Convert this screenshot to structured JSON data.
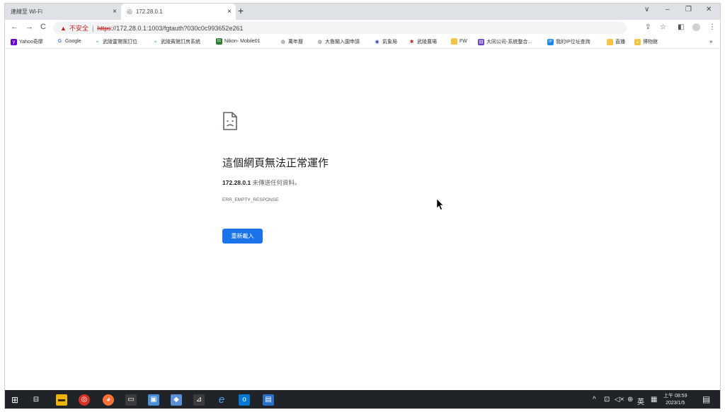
{
  "tabs": [
    {
      "label": "連線至 Wi-Fi",
      "close": "×"
    },
    {
      "label": "172.28.0.1",
      "close": "×"
    }
  ],
  "newtab": "+",
  "window_controls": {
    "chevron": "∨",
    "minimize": "–",
    "restore": "❐",
    "close": "✕"
  },
  "nav": {
    "back": "←",
    "forward": "→",
    "reload": "C"
  },
  "address": {
    "warning": "▲",
    "insecure": "不安全",
    "separator": "|",
    "scheme": "https",
    "rest": "://172.28.0.1:1003/fgtauth?030c0c993652e261"
  },
  "toolbar_icons": {
    "share": "⇪",
    "star": "☆",
    "sidepanel": "◧",
    "menu": "⋮"
  },
  "bookmarks": [
    {
      "label": "Yahoo奇摩",
      "color": "#6001d2",
      "glyph": "y"
    },
    {
      "label": "Google",
      "color": "#4285f4",
      "glyph": "G"
    },
    {
      "label": "武陵靈鷲匯訂位",
      "color": "#34a853",
      "glyph": "⌁"
    },
    {
      "label": "武陵賓館訂房系統",
      "color": "#34a853",
      "glyph": "⌁"
    },
    {
      "label": "Nikon- Mobile01",
      "color": "#2e7d32",
      "glyph": "01"
    },
    {
      "label": "萬年曆",
      "color": "#5f6368",
      "glyph": "◍"
    },
    {
      "label": "大魯閣入園申請",
      "color": "#5f6368",
      "glyph": "◍"
    },
    {
      "label": "氣象局",
      "color": "#3949ab",
      "glyph": "◉"
    },
    {
      "label": "武陵農場",
      "color": "#c62828",
      "glyph": "✱"
    },
    {
      "label": "FW",
      "color": "#f6c343",
      "glyph": ""
    },
    {
      "label": "大同公司-系統整合...",
      "color": "#673ab7",
      "glyph": "▤"
    },
    {
      "label": "我的IP位址查詢",
      "color": "#1e88e5",
      "glyph": "IP"
    },
    {
      "label": "直播",
      "color": "#f6c343",
      "glyph": ""
    },
    {
      "label": "博物館",
      "color": "#f6c343",
      "glyph": "◒"
    }
  ],
  "bookmarks_more": "»",
  "error": {
    "title": "這個網頁無法正常運作",
    "host": "172.28.0.1",
    "message": " 未傳送任何資料。",
    "code": "ERR_EMPTY_RESPONSE",
    "reload_label": "重新載入"
  },
  "taskbar": {
    "apps": [
      {
        "name": "start",
        "glyph": "⊞",
        "color": "#202428"
      },
      {
        "name": "task-view",
        "glyph": "⊟",
        "color": "#202428"
      },
      {
        "name": "file-explorer",
        "glyph": "▬",
        "color": "#f0b400"
      },
      {
        "name": "chrome",
        "glyph": "◎",
        "color": "#d93025"
      },
      {
        "name": "firefox",
        "glyph": "◕",
        "color": "#ff7139"
      },
      {
        "name": "terminal",
        "glyph": "▭",
        "color": "#3c3c3c"
      },
      {
        "name": "remote-desktop",
        "glyph": "▣",
        "color": "#4a90d9"
      },
      {
        "name": "app-blue",
        "glyph": "◆",
        "color": "#5b8fd6"
      },
      {
        "name": "network-app",
        "glyph": "⊿",
        "color": "#3c3c3c"
      },
      {
        "name": "internet-explorer",
        "glyph": "e",
        "color": "#202428"
      },
      {
        "name": "outlook",
        "glyph": "o",
        "color": "#0078d4"
      },
      {
        "name": "app-window",
        "glyph": "▤",
        "color": "#2a6fc9"
      }
    ],
    "tray": {
      "chevron": "^",
      "battery": "⊡",
      "volume": "◁×",
      "network": "⊕",
      "ime": "英",
      "ime2": "▦"
    },
    "clock": {
      "time": "上午 08:59",
      "date": "2023/1/5"
    },
    "notification": "▤"
  }
}
